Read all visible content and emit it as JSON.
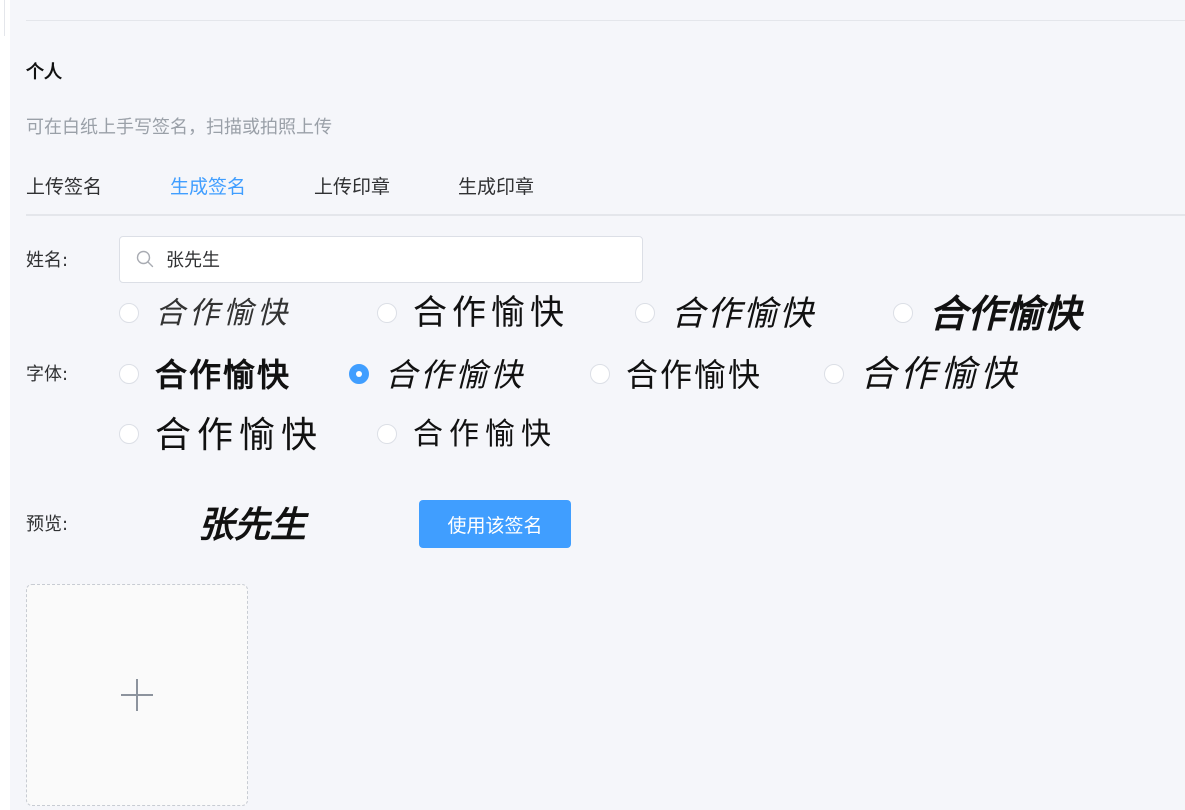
{
  "section": {
    "title": "个人",
    "hint": "可在白纸上手写签名，扫描或拍照上传"
  },
  "tabs": [
    {
      "label": "上传签名",
      "active": false
    },
    {
      "label": "生成签名",
      "active": true
    },
    {
      "label": "上传印章",
      "active": false
    },
    {
      "label": "生成印章",
      "active": false
    }
  ],
  "form": {
    "name_label": "姓名:",
    "name_value": "张先生",
    "font_label": "字体:",
    "preview_label": "预览:"
  },
  "fonts": {
    "sample_text": "合作愉快",
    "options": [
      {
        "id": "font-1",
        "selected": false
      },
      {
        "id": "font-2",
        "selected": false
      },
      {
        "id": "font-3",
        "selected": false
      },
      {
        "id": "font-4",
        "selected": false
      },
      {
        "id": "font-5",
        "selected": false
      },
      {
        "id": "font-6",
        "selected": true
      },
      {
        "id": "font-7",
        "selected": false
      },
      {
        "id": "font-8",
        "selected": false
      },
      {
        "id": "font-9",
        "selected": false
      },
      {
        "id": "font-10",
        "selected": false
      }
    ]
  },
  "preview": {
    "text": "张先生"
  },
  "actions": {
    "use_signature_label": "使用该签名"
  },
  "icons": {
    "search": "search-icon",
    "plus": "plus-icon"
  },
  "colors": {
    "accent": "#409eff",
    "panel_bg": "#f5f6fa",
    "hint_text": "#9aa0a8",
    "border": "#dcdfe6"
  }
}
